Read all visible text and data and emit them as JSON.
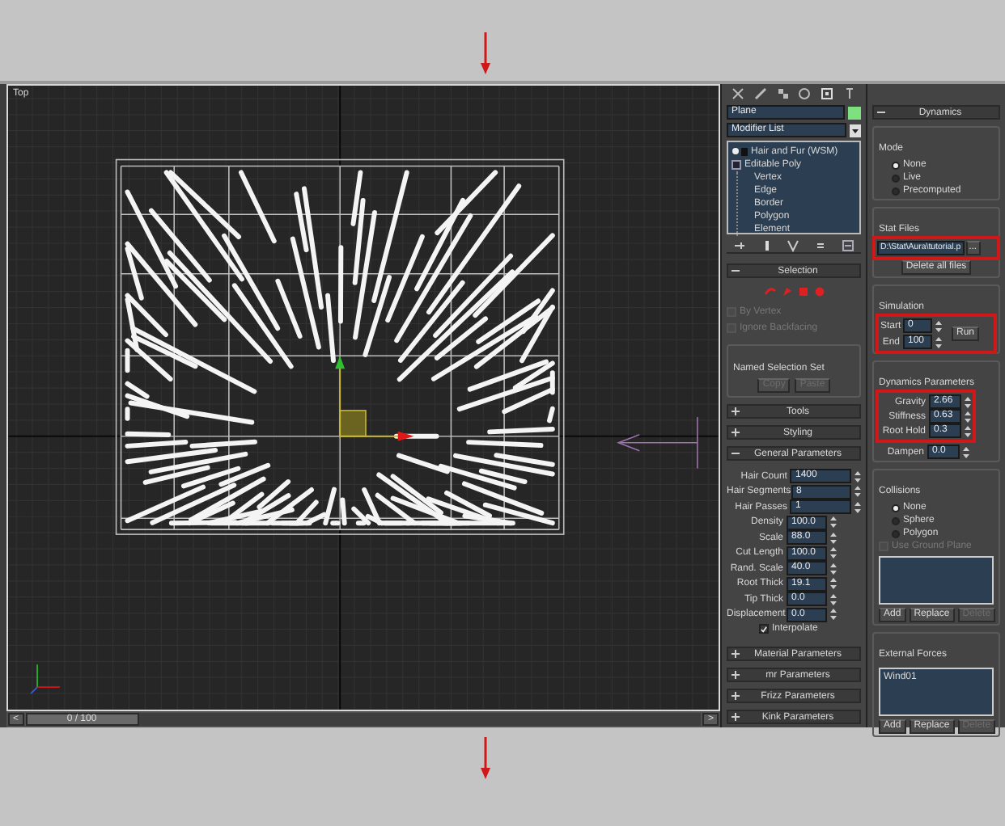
{
  "viewport": {
    "label": "Top"
  },
  "timeline": {
    "prev": "<",
    "position": "0 / 100",
    "next": ">",
    "level": 0
  },
  "modify_panel": {
    "object_name": "Plane",
    "modifier_list": "Modifier List",
    "stack": [
      {
        "label": "Hair and Fur (WSM)",
        "kind": "modifier"
      },
      {
        "label": "Editable Poly",
        "kind": "object",
        "expanded": true,
        "children": [
          {
            "label": "Vertex"
          },
          {
            "label": "Edge"
          },
          {
            "label": "Border"
          },
          {
            "label": "Polygon"
          },
          {
            "label": "Element"
          }
        ]
      }
    ],
    "selection": {
      "title": "Selection",
      "expanded": true,
      "options": [
        {
          "label": "By Vertex",
          "checked": false,
          "disabled": true
        },
        {
          "label": "Ignore Backfacing",
          "checked": false,
          "disabled": true
        }
      ],
      "named_set": "Named Selection Set",
      "buttons": [
        {
          "label": "Copy",
          "disabled": true
        },
        {
          "label": "Paste",
          "disabled": true
        }
      ]
    },
    "rollouts": [
      {
        "title": "Tools",
        "expanded": false
      },
      {
        "title": "Styling",
        "expanded": false
      },
      {
        "title": "General Parameters",
        "expanded": true
      }
    ],
    "general_parameters": [
      {
        "label": "Hair Count",
        "value": "1400",
        "kind": "wide"
      },
      {
        "label": "Hair Segments",
        "value": "8",
        "kind": "wide"
      },
      {
        "label": "Hair Passes",
        "value": "1",
        "kind": "wide"
      },
      {
        "label": "Density",
        "value": "100.0",
        "kind": "narrow"
      },
      {
        "label": "Scale",
        "value": "88.0",
        "kind": "narrow"
      },
      {
        "label": "Cut Length",
        "value": "100.0",
        "kind": "narrow"
      },
      {
        "label": "Rand. Scale",
        "value": "40.0",
        "kind": "narrow"
      },
      {
        "label": "Root Thick",
        "value": "19.1",
        "kind": "narrow"
      },
      {
        "label": "Tip Thick",
        "value": "0.0",
        "kind": "narrow"
      },
      {
        "label": "Displacement",
        "value": "0.0",
        "kind": "narrow"
      }
    ],
    "interpolate": {
      "label": "Interpolate",
      "checked": true
    },
    "lower_rollouts": [
      {
        "title": "Material Parameters",
        "expanded": false
      },
      {
        "title": "mr Parameters",
        "expanded": false
      },
      {
        "title": "Frizz Parameters",
        "expanded": false
      },
      {
        "title": "Kink Parameters",
        "expanded": false
      }
    ]
  },
  "dynamics_panel": {
    "title": "Dynamics",
    "expanded": true,
    "mode_label": "Mode",
    "modes": [
      {
        "label": "None",
        "selected": true
      },
      {
        "label": "Live",
        "selected": false
      },
      {
        "label": "Precomputed",
        "selected": false
      }
    ],
    "stat_files_label": "Stat Files",
    "stat_path": "D:\\Stat\\Aura\\tutorial.p",
    "browse": "...",
    "delete_all": "Delete all files",
    "simulation_label": "Simulation",
    "start_label": "Start",
    "start": "0",
    "end_label": "End",
    "end": "100",
    "run": "Run",
    "parameters_label": "Dynamics Parameters",
    "parameters": [
      {
        "label": "Gravity",
        "value": "2.66"
      },
      {
        "label": "Stiffness",
        "value": "0.63"
      },
      {
        "label": "Root Hold",
        "value": "0.3"
      },
      {
        "label": "Dampen",
        "value": "0.0"
      }
    ],
    "collisions_label": "Collisions",
    "collisions": [
      {
        "label": "None",
        "selected": true
      },
      {
        "label": "Sphere",
        "selected": false
      },
      {
        "label": "Polygon",
        "selected": false
      }
    ],
    "ground_plane": {
      "label": "Use Ground Plane",
      "checked": false,
      "disabled": true
    },
    "collision_buttons": [
      {
        "label": "Add",
        "disabled": false
      },
      {
        "label": "Replace",
        "disabled": false
      },
      {
        "label": "Delete",
        "disabled": true
      }
    ],
    "external_forces_label": "External Forces",
    "external_forces": [
      "Wind01"
    ],
    "force_buttons": [
      {
        "label": "Add",
        "disabled": false
      },
      {
        "label": "Replace",
        "disabled": false
      },
      {
        "label": "Delete",
        "disabled": true
      }
    ]
  }
}
